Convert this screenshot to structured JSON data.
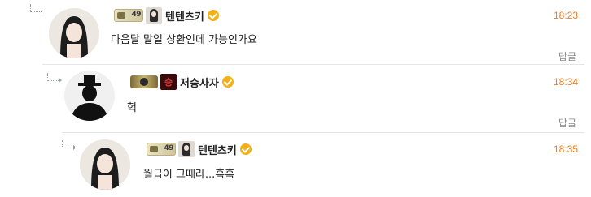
{
  "comments": [
    {
      "nickname": "텐텐츠키",
      "level": "49",
      "time": "18:23",
      "text": "다음달 말일 상환인데 가능인가요",
      "reply_label": "답글"
    },
    {
      "nickname": "저승사자",
      "mini_avatar_char": "승",
      "time": "18:34",
      "text": "헉",
      "reply_label": "답글"
    },
    {
      "nickname": "텐텐츠키",
      "level": "49",
      "time": "18:35",
      "text": "월급이 그때라...흑흑"
    }
  ],
  "colors": {
    "time": "#f07d1f",
    "verified": "#f2b215",
    "divider": "#e6e6e6"
  },
  "icons": {
    "reply_arrow": "reply-arrow-icon",
    "verified": "verified-badge-icon"
  }
}
